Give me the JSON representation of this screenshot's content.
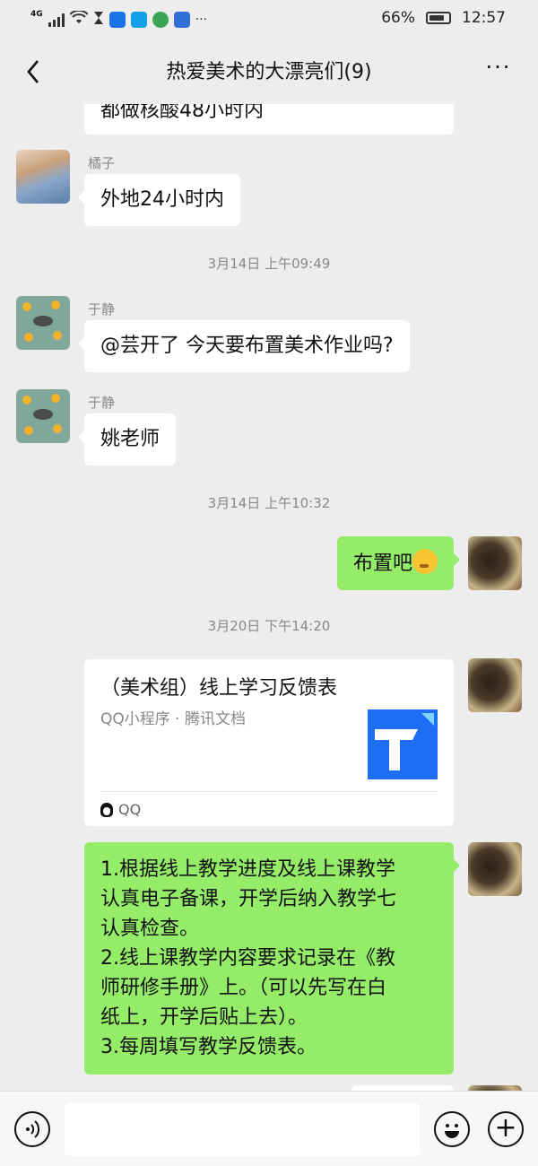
{
  "status_bar": {
    "network": "4G",
    "battery_percent": "66%",
    "time": "12:57"
  },
  "header": {
    "title": "热爱美术的大漂亮们(9)",
    "more_label": "···"
  },
  "messages": {
    "partial_top": "都做核酸48小时内",
    "m1": {
      "sender": "橘子",
      "text": "外地24小时内"
    },
    "t1": "3月14日 上午09:49",
    "m2": {
      "sender": "于静",
      "text": "@芸开了  今天要布置美术作业吗?"
    },
    "m3": {
      "sender": "于静",
      "text": "姚老师"
    },
    "t2": "3月14日 上午10:32",
    "m4": {
      "text": "布置吧"
    },
    "t3": "3月20日 下午14:20",
    "card": {
      "title": "（美术组）线上学习反馈表",
      "source": "QQ小程序 · 腾讯文档",
      "footer": "QQ"
    },
    "m5": {
      "lines": [
        "1.根据线上教学进度及线上课教学",
        "认真电子备课，开学后纳入教学七",
        "认真检查。",
        "2.线上课教学内容要求记录在《教",
        "师研修手册》上。（可以先写在白",
        "纸上，开学后贴上去）。",
        "3.每周填写教学反馈表。"
      ]
    }
  },
  "input": {
    "placeholder": ""
  },
  "colors": {
    "bg": "#ededed",
    "self_bubble": "#95ec69",
    "other_bubble": "#ffffff",
    "thumb_blue": "#1e6ef5"
  }
}
